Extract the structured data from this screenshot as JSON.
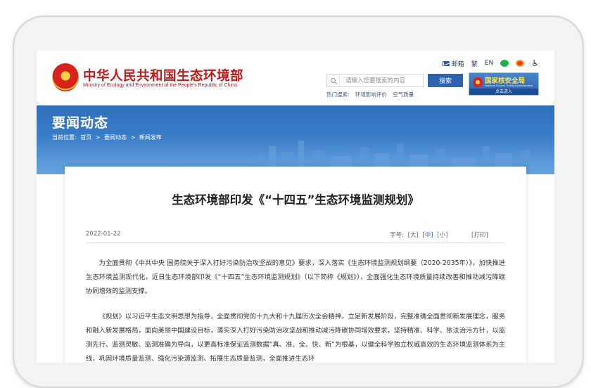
{
  "header": {
    "site_title": "中华人民共和国生态环境部",
    "site_subtitle": "Ministry of Ecology and Environment of the People's Republic of China",
    "top_links": {
      "mail": "邮箱",
      "traditional": "繁",
      "english": "EN"
    },
    "search": {
      "placeholder": "请输入您要搜索的内容",
      "button": "搜索"
    },
    "hot_search": {
      "label": "热门搜索:",
      "items": [
        "环境影响评价",
        "空气质量"
      ]
    },
    "nnsa_banner": {
      "title": "国家核安全局",
      "subtitle": "National Nuclear Safety Administration",
      "enter": "点击进入"
    }
  },
  "banner": {
    "section_title": "要闻动态",
    "breadcrumb": {
      "prefix": "当前位置:",
      "items": [
        "首页",
        ">",
        "要闻动态",
        ">",
        "新闻发布"
      ]
    }
  },
  "article": {
    "title": "生态环境部印发《“十四五”生态环境监测规划》",
    "date": "2022-01-22",
    "font_size": {
      "label": "字号:",
      "options": [
        "[大]",
        "[中]",
        "[小]"
      ],
      "selected": "[中]"
    },
    "print": "[打印]",
    "paragraphs": [
      "为全面贯彻《中共中央 国务院关于深入打好污染防治攻坚战的意见》要求，深入落实《生态环境监测规划纲要（2020-2035年）》，加快推进生态环境监测现代化，近日生态环境部印发《“十四五”生态环境监测规划》（以下简称《规划》），全面强化生态环境质量持续改善和推动减污降碳协同增效的监测支撑。",
      "《规划》以习近平生态文明思想为指导，全面贯彻党的十九大和十九届历次全会精神，立足新发展阶段，完整准确全面贯彻新发展理念，服务和融入新发展格局，面向美丽中国建设目标，落实深入打好污染防治攻坚战和推动减污降碳协同增效要求，坚持精准、科学、依法治污方针，以监测先行、监测灵敏、监测准确为导向，以更高标准保证监测数据“真、准、全、快、新”为根基，以健全科学独立权威高效的生态环境监测体系为主线，巩固环境质量监测、强化污染源监测、拓展生态质量监测，全面推进生态环"
    ]
  },
  "colors": {
    "brand_red": "#c01919",
    "banner_blue": "#3b7fca",
    "search_button": "#2e63b1"
  }
}
